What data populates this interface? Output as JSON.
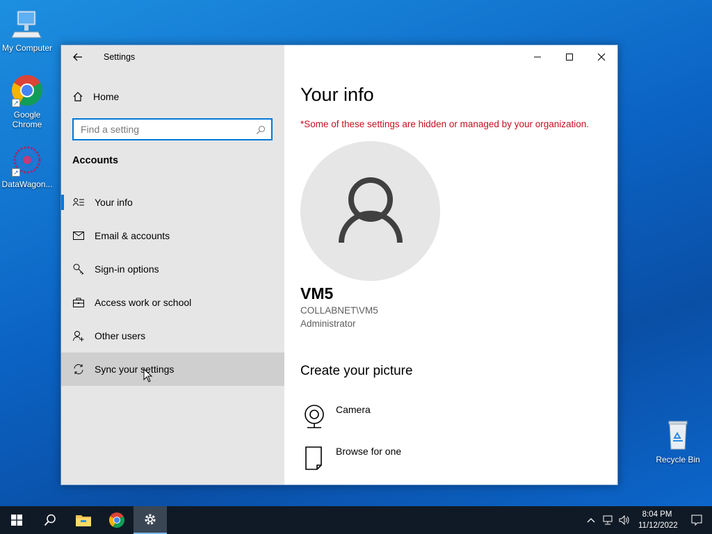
{
  "desktop": {
    "icons": [
      {
        "label": "My Computer",
        "icon": "computer-icon"
      },
      {
        "label": "Google Chrome",
        "icon": "chrome-icon"
      },
      {
        "label": "DataWagon...",
        "icon": "datawagon-icon"
      },
      {
        "label": "Recycle Bin",
        "icon": "recycle-bin-icon"
      }
    ]
  },
  "window": {
    "app_title": "Settings",
    "sidebar": {
      "home_label": "Home",
      "search_placeholder": "Find a setting",
      "section_label": "Accounts",
      "items": [
        {
          "label": "Your info",
          "icon": "person-card-icon",
          "selected": true
        },
        {
          "label": "Email & accounts",
          "icon": "mail-icon"
        },
        {
          "label": "Sign-in options",
          "icon": "key-icon"
        },
        {
          "label": "Access work or school",
          "icon": "briefcase-icon"
        },
        {
          "label": "Other users",
          "icon": "person-add-icon"
        },
        {
          "label": "Sync your settings",
          "icon": "sync-icon",
          "hovered": true
        }
      ]
    },
    "content": {
      "title": "Your info",
      "org_notice": "*Some of these settings are hidden or managed by your organization.",
      "user": {
        "name": "VM5",
        "domain_account": "COLLABNET\\VM5",
        "role": "Administrator"
      },
      "create_picture_heading": "Create your picture",
      "options": [
        {
          "label": "Camera",
          "icon": "camera-icon"
        },
        {
          "label": "Browse for one",
          "icon": "document-icon"
        }
      ]
    }
  },
  "taskbar": {
    "time": "8:04 PM",
    "date": "11/12/2022",
    "pinned": [
      "start-icon",
      "search-icon",
      "file-explorer-icon",
      "chrome-icon",
      "settings-icon"
    ]
  },
  "colors": {
    "accent": "#0078d7",
    "warning_text": "#c50f1f",
    "sidebar_bg": "#e6e6e6",
    "taskbar_bg": "#101a26"
  }
}
